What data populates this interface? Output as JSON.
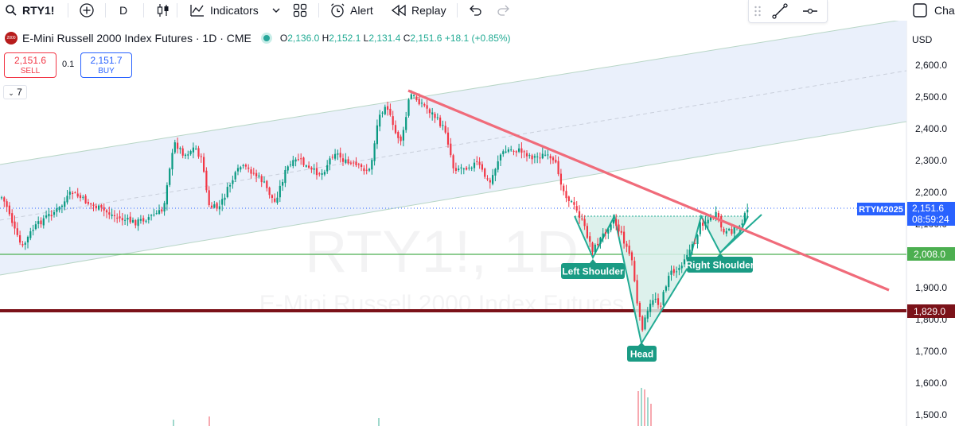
{
  "toolbar": {
    "symbol": "RTY1!",
    "interval": "D",
    "indicators_label": "Indicators",
    "alert_label": "Alert",
    "replay_label": "Replay",
    "chart_cut_label": "Cha"
  },
  "legend": {
    "logo_text": "2000",
    "title": "E-Mini Russell 2000 Index Futures · 1D · CME",
    "open_label": "O",
    "open": "2,136.0",
    "high_label": "H",
    "high": "2,152.1",
    "low_label": "L",
    "low": "2,131.4",
    "close_label": "C",
    "close": "2,151.6",
    "change": "+18.1 (+0.85%)"
  },
  "trade": {
    "sell_price": "2,151.6",
    "sell_label": "SELL",
    "spread": "0.1",
    "buy_price": "2,151.7",
    "buy_label": "BUY"
  },
  "indicators_collapsed_count": "7",
  "watermark": {
    "symbol": "RTY1!, 1D",
    "name": "E-Mini Russell 2000 Index Futures"
  },
  "price_axis": {
    "currency": "USD",
    "ticks": [
      "2,600.0",
      "2,500.0",
      "2,400.0",
      "2,300.0",
      "2,200.0",
      "2,100.0",
      "1,900.0",
      "1,800.0",
      "1,700.0",
      "1,600.0",
      "1,500.0"
    ],
    "current_tag_symbol": "RTYM2025",
    "current_price": "2,151.6",
    "countdown": "08:59:24",
    "support_level": "2,008.0",
    "key_level": "1,829.0"
  },
  "annotations": {
    "left_shoulder": "Left Shoulder",
    "head": "Head",
    "right_shoulder": "Right Shoulder"
  },
  "colors": {
    "up": "#089981",
    "down": "#f23645",
    "trendline": "#f06b7a",
    "support": "#4caf50",
    "key_level": "#7b1219",
    "pattern": "#22ab94",
    "label_bg": "#1a9b84",
    "current_price_tag": "#2962ff"
  }
}
